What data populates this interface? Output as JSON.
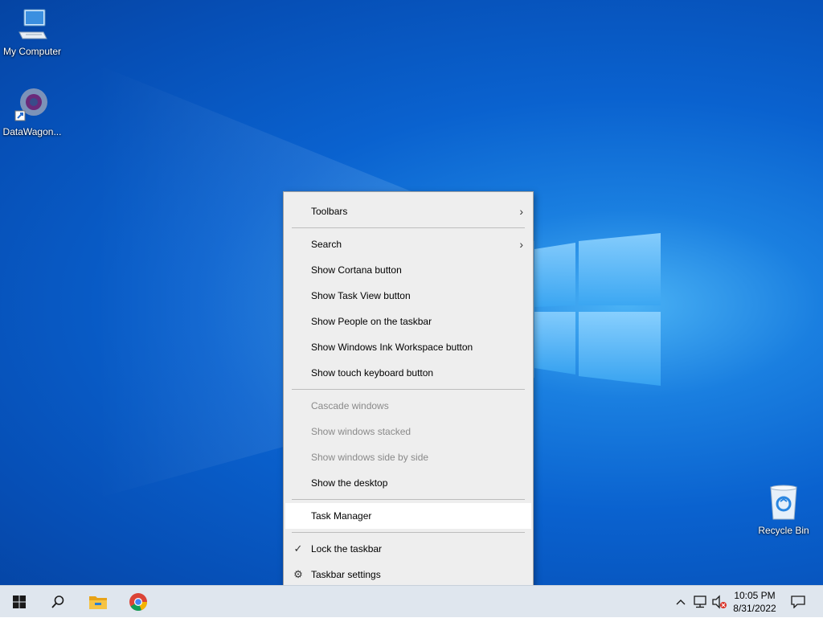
{
  "desktop": {
    "icons": [
      {
        "label": "My Computer"
      },
      {
        "label": "DataWagon..."
      },
      {
        "label": "Recycle Bin"
      }
    ]
  },
  "context_menu": {
    "items": {
      "toolbars": "Toolbars",
      "search": "Search",
      "show_cortana": "Show Cortana button",
      "show_task_view": "Show Task View button",
      "show_people": "Show People on the taskbar",
      "show_ink": "Show Windows Ink Workspace button",
      "show_touch_keyboard": "Show touch keyboard button",
      "cascade": "Cascade windows",
      "stacked": "Show windows stacked",
      "side_by_side": "Show windows side by side",
      "show_desktop": "Show the desktop",
      "task_manager": "Task Manager",
      "lock_taskbar": "Lock the taskbar",
      "taskbar_settings": "Taskbar settings"
    },
    "submenu_arrow": "›",
    "check_glyph": "✓",
    "gear_glyph": "⚙"
  },
  "taskbar": {
    "clock_time": "10:05 PM",
    "clock_date": "8/31/2022",
    "icons": [
      "windows-start-icon",
      "search-icon",
      "file-explorer-icon",
      "chrome-icon",
      "chevron-up-icon",
      "network-icon",
      "volume-muted-icon",
      "notification-icon"
    ]
  },
  "colors": {
    "desktop_blue": "#0a62cf",
    "menu_bg": "#eeeeee",
    "taskbar_bg": "#dfe6ee"
  }
}
